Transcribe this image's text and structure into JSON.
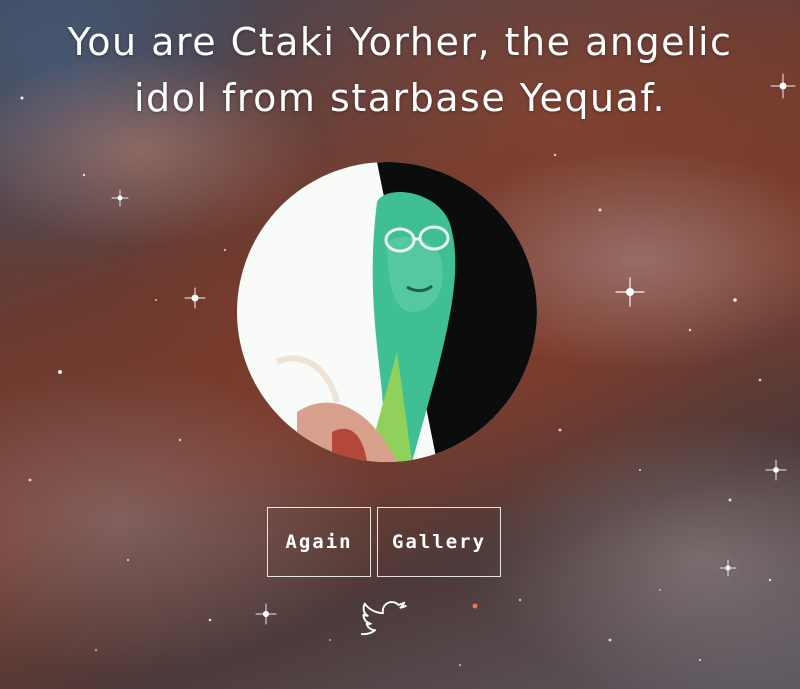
{
  "result": {
    "line1": "You are Ctaki Yorher, the angelic",
    "line2": "idol from starbase Yequaf."
  },
  "avatar": {
    "alt": "Generated idol portrait"
  },
  "actions": {
    "again_label": "Again",
    "gallery_label": "Gallery"
  },
  "share": {
    "icon": "twitter-bird-icon"
  },
  "colors": {
    "text": "#ffffff",
    "button_border": "#ffffff"
  }
}
